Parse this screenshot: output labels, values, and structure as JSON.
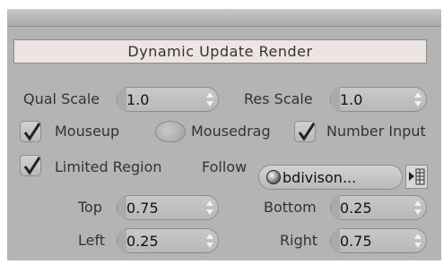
{
  "title": "Dynamic Update Render",
  "qual_scale": {
    "label": "Qual Scale",
    "value": "1.0"
  },
  "res_scale": {
    "label": "Res Scale",
    "value": "1.0"
  },
  "mouseup": {
    "label": "Mouseup",
    "checked": true
  },
  "mousedrag": {
    "label": "Mousedrag",
    "checked": false
  },
  "number_input": {
    "label": "Number Input",
    "checked": true
  },
  "limited_region": {
    "label": "Limited Region",
    "checked": true
  },
  "follow": {
    "label": "Follow",
    "value": "bdivison..."
  },
  "top": {
    "label": "Top",
    "value": "0.75"
  },
  "bottom": {
    "label": "Bottom",
    "value": "0.25"
  },
  "left": {
    "label": "Left",
    "value": "0.25"
  },
  "right": {
    "label": "Right",
    "value": "0.75"
  },
  "icons": [
    "spinner-arrows-icon",
    "checkmark-icon",
    "radio-icon",
    "object-sphere-icon",
    "picker-icon"
  ]
}
